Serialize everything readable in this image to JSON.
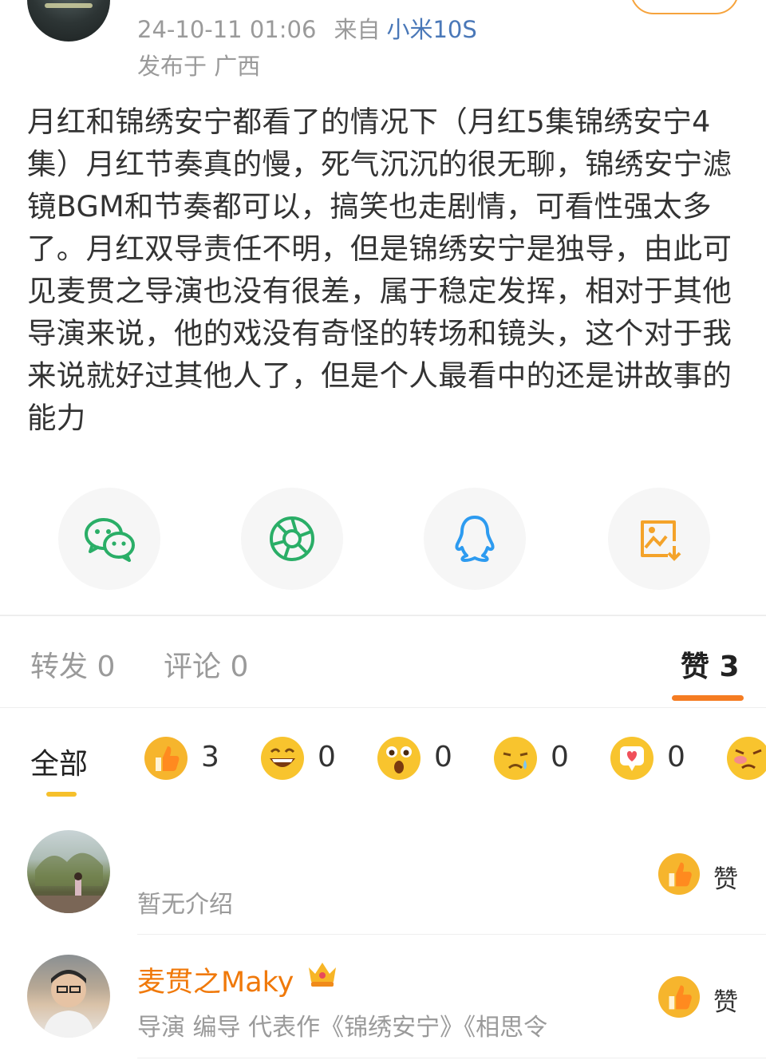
{
  "post": {
    "meta": {
      "date": "24-10-11 01:06",
      "from_label": "来自",
      "device": "小米10S",
      "location": "发布于 广西"
    },
    "text": "月红和锦绣安宁都看了的情况下（月红5集锦绣安宁4集）月红节奏真的慢，死气沉沉的很无聊，锦绣安宁滤镜BGM和节奏都可以，搞笑也走剧情，可看性强太多了。月红双导责任不明，但是锦绣安宁是独导，由此可见麦贯之导演也没有很差，属于稳定发挥，相对于其他导演来说，他的戏没有奇怪的转场和镜头，这个对于我来说就好过其他人了，但是个人最看中的还是讲故事的能力"
  },
  "share": {
    "items": [
      {
        "icon": "wechat-icon",
        "color": "#2aae67"
      },
      {
        "icon": "moments-icon",
        "color": "#2aae67"
      },
      {
        "icon": "qq-icon",
        "color": "#2d9bf0"
      },
      {
        "icon": "save-image-icon",
        "color": "#f4a32a"
      }
    ]
  },
  "tabs": {
    "repost": "转发 0",
    "comment": "评论 0",
    "like": "赞 3"
  },
  "reactions": {
    "all_label": "全部",
    "items": [
      {
        "icon": "thumbs-up-icon",
        "count": "3"
      },
      {
        "icon": "laugh-icon",
        "count": "0"
      },
      {
        "icon": "surprised-icon",
        "count": "0"
      },
      {
        "icon": "sad-icon",
        "count": "0"
      },
      {
        "icon": "heart-icon",
        "count": "0"
      },
      {
        "icon": "angry-icon",
        "count": ""
      }
    ]
  },
  "users": [
    {
      "name": "",
      "intro": "暂无介绍",
      "like_label": "赞"
    },
    {
      "name": "麦贯之Maky",
      "intro": "导演 编导 代表作《锦绣安宁》《相思令",
      "like_label": "赞"
    }
  ],
  "colors": {
    "accent": "#f57c22",
    "link": "#4a78b8",
    "name": "#f0790a",
    "muted": "#9a9a9a"
  }
}
